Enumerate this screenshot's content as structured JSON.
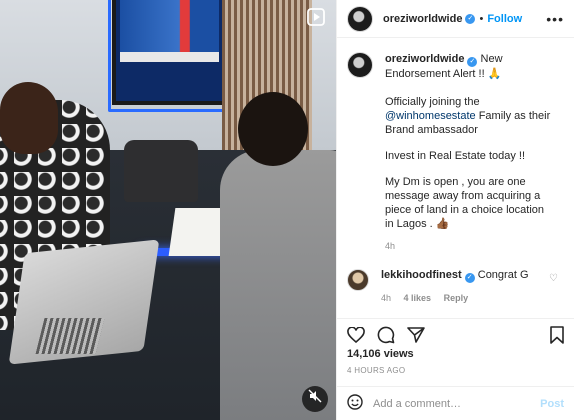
{
  "header": {
    "username": "oreziworldwide",
    "separator": "•",
    "follow_label": "Follow",
    "more_icon": "more-icon"
  },
  "caption": {
    "username": "oreziworldwide",
    "line1": "New Endorsement Alert !! 🙏",
    "line2a": "Officially joining the ",
    "mention": "@winhomesestate",
    "line2b": " Family as their Brand ambassador",
    "line3": "Invest in Real Estate today !!",
    "line4": "My Dm is open , you are one message away from acquiring a piece of land in a choice location in Lagos . 👍🏾",
    "time": "4h"
  },
  "reply": {
    "username": "lekkihoodfinest",
    "text": "Congrat G",
    "time": "4h",
    "likes": "4 likes",
    "reply_label": "Reply"
  },
  "actions": {
    "like_icon": "heart-icon",
    "comment_icon": "comment-icon",
    "share_icon": "share-icon",
    "save_icon": "bookmark-icon"
  },
  "stats": {
    "views": "14,106 views",
    "posted": "4 HOURS AGO"
  },
  "add_comment": {
    "placeholder": "Add a comment…",
    "post_label": "Post"
  },
  "colors": {
    "accent": "#0095f6",
    "verified": "#3897f0",
    "muted": "#8e8e8e",
    "link": "#00376b"
  }
}
